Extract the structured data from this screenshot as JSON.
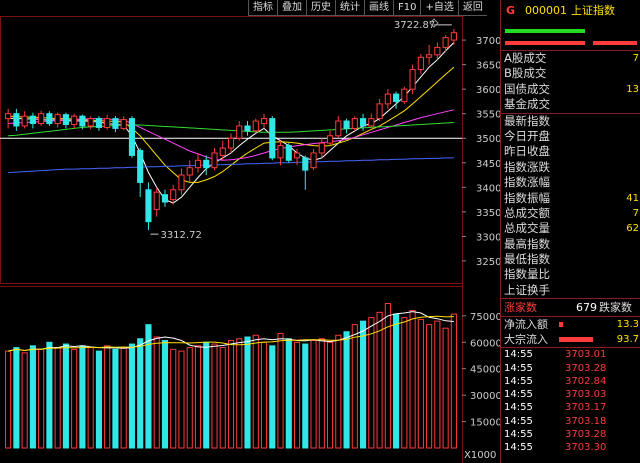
{
  "toolbar": {
    "items": [
      "指标",
      "叠加",
      "历史",
      "统计",
      "画线",
      "F10",
      "+自选",
      "返回"
    ]
  },
  "header": {
    "marker": "G",
    "code": "000001",
    "name": "上证指数"
  },
  "colors": {
    "up": "#ff3b3b",
    "down": "#33e6e6",
    "grid": "#7a1010",
    "ref": "#ffffff",
    "ma5": "#ffffff",
    "ma10": "#ffe000",
    "ma20": "#ff44ff",
    "ma60": "#33dd33",
    "ma120": "#4466ff"
  },
  "right_panel": {
    "rows": [
      {
        "label": "A股成交",
        "value": "7"
      },
      {
        "label": "B股成交",
        "value": ""
      },
      {
        "label": "国债成交",
        "value": "13"
      },
      {
        "label": "基金成交",
        "value": ""
      },
      {
        "label": "最新指数",
        "value": ""
      },
      {
        "label": "今日开盘",
        "value": ""
      },
      {
        "label": "昨日收盘",
        "value": ""
      },
      {
        "label": "指数涨跌",
        "value": ""
      },
      {
        "label": "指数涨幅",
        "value": ""
      },
      {
        "label": "指数振幅",
        "value": "41"
      },
      {
        "label": "总成交额",
        "value": "7"
      },
      {
        "label": "总成交量",
        "value": "62"
      },
      {
        "label": "最高指数",
        "value": ""
      },
      {
        "label": "最低指数",
        "value": ""
      },
      {
        "label": "指数量比",
        "value": ""
      },
      {
        "label": "上证换手",
        "value": ""
      }
    ],
    "updown": {
      "up_label": "涨家数",
      "up_count": "679",
      "down_label": "跌家数"
    },
    "flows": [
      {
        "label": "净流入额",
        "value": "13.3",
        "bar": 0.1
      },
      {
        "label": "大宗流入",
        "value": "93.7",
        "bar": 0.85
      }
    ],
    "ticks": [
      {
        "time": "14:55",
        "price": "3703.01"
      },
      {
        "time": "14:55",
        "price": "3703.28"
      },
      {
        "time": "14:55",
        "price": "3702.84"
      },
      {
        "time": "14:55",
        "price": "3703.03"
      },
      {
        "time": "14:55",
        "price": "3703.17"
      },
      {
        "time": "14:55",
        "price": "3703.18"
      },
      {
        "time": "14:55",
        "price": "3703.28"
      },
      {
        "time": "14:55",
        "price": "3703.30"
      }
    ]
  },
  "chart_data": {
    "type": "candlestick",
    "price_axis": {
      "ticks": [
        3250,
        3300,
        3350,
        3400,
        3450,
        3500,
        3550,
        3600,
        3650,
        3700
      ],
      "range": [
        3205,
        3745
      ]
    },
    "volume_axis": {
      "ticks": [
        15000,
        30000,
        45000,
        60000,
        75000
      ],
      "range": [
        0,
        84000
      ],
      "unit_label": "X1000"
    },
    "reference_level": 3500,
    "annotations": {
      "high": "3722.87",
      "low": "3312.72"
    },
    "candles": [
      [
        3540,
        3550,
        3520,
        3560
      ],
      [
        3550,
        3525,
        3515,
        3560
      ],
      [
        3525,
        3545,
        3520,
        3555
      ],
      [
        3545,
        3530,
        3520,
        3552
      ],
      [
        3530,
        3550,
        3525,
        3556
      ],
      [
        3550,
        3530,
        3525,
        3555
      ],
      [
        3530,
        3548,
        3522,
        3552
      ],
      [
        3548,
        3528,
        3520,
        3552
      ],
      [
        3528,
        3545,
        3520,
        3550
      ],
      [
        3545,
        3525,
        3518,
        3548
      ],
      [
        3525,
        3540,
        3518,
        3545
      ],
      [
        3540,
        3522,
        3515,
        3545
      ],
      [
        3522,
        3540,
        3518,
        3548
      ],
      [
        3540,
        3520,
        3512,
        3545
      ],
      [
        3520,
        3538,
        3516,
        3545
      ],
      [
        3540,
        3465,
        3460,
        3545
      ],
      [
        3475,
        3410,
        3380,
        3480
      ],
      [
        3395,
        3330,
        3312.72,
        3410
      ],
      [
        3355,
        3390,
        3340,
        3400
      ],
      [
        3385,
        3370,
        3360,
        3395
      ],
      [
        3375,
        3395,
        3365,
        3405
      ],
      [
        3395,
        3425,
        3385,
        3438
      ],
      [
        3425,
        3440,
        3410,
        3455
      ],
      [
        3440,
        3455,
        3430,
        3470
      ],
      [
        3455,
        3440,
        3425,
        3465
      ],
      [
        3440,
        3470,
        3435,
        3480
      ],
      [
        3465,
        3480,
        3455,
        3495
      ],
      [
        3480,
        3500,
        3470,
        3510
      ],
      [
        3500,
        3525,
        3495,
        3535
      ],
      [
        3525,
        3515,
        3505,
        3535
      ],
      [
        3515,
        3535,
        3510,
        3540
      ],
      [
        3530,
        3540,
        3520,
        3550
      ],
      [
        3540,
        3460,
        3455,
        3545
      ],
      [
        3460,
        3485,
        3445,
        3495
      ],
      [
        3485,
        3455,
        3450,
        3490
      ],
      [
        3460,
        3470,
        3445,
        3478
      ],
      [
        3460,
        3435,
        3395,
        3465
      ],
      [
        3440,
        3470,
        3435,
        3478
      ],
      [
        3470,
        3490,
        3460,
        3500
      ],
      [
        3490,
        3505,
        3485,
        3515
      ],
      [
        3505,
        3535,
        3500,
        3545
      ],
      [
        3535,
        3520,
        3510,
        3540
      ],
      [
        3520,
        3540,
        3515,
        3545
      ],
      [
        3540,
        3525,
        3515,
        3550
      ],
      [
        3525,
        3540,
        3520,
        3550
      ],
      [
        3540,
        3570,
        3535,
        3580
      ],
      [
        3570,
        3590,
        3560,
        3600
      ],
      [
        3590,
        3575,
        3560,
        3595
      ],
      [
        3575,
        3600,
        3570,
        3605
      ],
      [
        3600,
        3640,
        3590,
        3650
      ],
      [
        3640,
        3665,
        3630,
        3672
      ],
      [
        3665,
        3670,
        3650,
        3690
      ],
      [
        3670,
        3685,
        3660,
        3695
      ],
      [
        3685,
        3705,
        3675,
        3710
      ],
      [
        3700,
        3715,
        3690,
        3722.87
      ]
    ],
    "volumes": [
      55000,
      57000,
      54000,
      58000,
      56000,
      60000,
      57000,
      59000,
      56000,
      58000,
      57000,
      55000,
      58000,
      56000,
      57000,
      59000,
      62000,
      70000,
      63000,
      61000,
      56000,
      55000,
      57000,
      58000,
      60000,
      59000,
      57000,
      61000,
      62000,
      63000,
      64000,
      60000,
      58000,
      65000,
      62000,
      60000,
      59000,
      61000,
      62000,
      60000,
      64000,
      66000,
      70000,
      72000,
      74000,
      77000,
      82000,
      76000,
      74000,
      78000,
      73000,
      70000,
      72000,
      68000,
      76000
    ],
    "moving_averages": {
      "ma5": [
        3540,
        3541,
        3539,
        3540,
        3538,
        3537,
        3538,
        3536,
        3535,
        3536,
        3534,
        3533,
        3530,
        3528,
        3527,
        3505,
        3470,
        3430,
        3400,
        3375,
        3368,
        3380,
        3400,
        3420,
        3438,
        3450,
        3460,
        3470,
        3485,
        3498,
        3510,
        3520,
        3505,
        3495,
        3485,
        3470,
        3460,
        3455,
        3460,
        3475,
        3490,
        3505,
        3515,
        3525,
        3530,
        3540,
        3555,
        3570,
        3585,
        3605,
        3625,
        3645,
        3660,
        3678,
        3695
      ],
      "ma10": [
        3545,
        3544,
        3543,
        3543,
        3542,
        3541,
        3540,
        3540,
        3539,
        3538,
        3537,
        3536,
        3535,
        3534,
        3533,
        3520,
        3505,
        3485,
        3465,
        3445,
        3430,
        3415,
        3410,
        3410,
        3415,
        3422,
        3432,
        3445,
        3458,
        3470,
        3480,
        3490,
        3492,
        3493,
        3492,
        3490,
        3487,
        3485,
        3484,
        3485,
        3490,
        3495,
        3502,
        3510,
        3518,
        3525,
        3535,
        3545,
        3556,
        3570,
        3585,
        3600,
        3615,
        3630,
        3645
      ],
      "ma20": [
        3530,
        3531,
        3532,
        3533,
        3534,
        3535,
        3536,
        3537,
        3538,
        3539,
        3540,
        3540,
        3539,
        3538,
        3537,
        3530,
        3522,
        3514,
        3506,
        3498,
        3490,
        3482,
        3474,
        3468,
        3462,
        3457,
        3455,
        3456,
        3458,
        3461,
        3465,
        3470,
        3475,
        3479,
        3482,
        3485,
        3487,
        3489,
        3491,
        3493,
        3495,
        3498,
        3502,
        3507,
        3512,
        3517,
        3522,
        3527,
        3532,
        3537,
        3542,
        3546,
        3550,
        3554,
        3558
      ],
      "ma60": [
        3505,
        3506,
        3508,
        3510,
        3512,
        3514,
        3516,
        3518,
        3520,
        3522,
        3523,
        3524,
        3525,
        3526,
        3527,
        3527,
        3527,
        3526,
        3525,
        3524,
        3523,
        3522,
        3521,
        3520,
        3519,
        3518,
        3517,
        3516,
        3515,
        3514,
        3513,
        3512,
        3512,
        3512,
        3512,
        3513,
        3514,
        3515,
        3516,
        3517,
        3518,
        3519,
        3520,
        3521,
        3522,
        3523,
        3524,
        3525,
        3526,
        3527,
        3528,
        3529,
        3530,
        3531,
        3532
      ],
      "ma120": [
        3430,
        3431,
        3432,
        3433,
        3434,
        3435,
        3436,
        3437,
        3437,
        3438,
        3438,
        3439,
        3439,
        3440,
        3440,
        3441,
        3441,
        3442,
        3442,
        3443,
        3443,
        3444,
        3444,
        3445,
        3445,
        3446,
        3446,
        3447,
        3447,
        3448,
        3448,
        3449,
        3449,
        3450,
        3450,
        3451,
        3451,
        3452,
        3452,
        3453,
        3453,
        3454,
        3454,
        3455,
        3455,
        3456,
        3456,
        3457,
        3457,
        3458,
        3458,
        3459,
        3459,
        3460,
        3460
      ]
    }
  }
}
